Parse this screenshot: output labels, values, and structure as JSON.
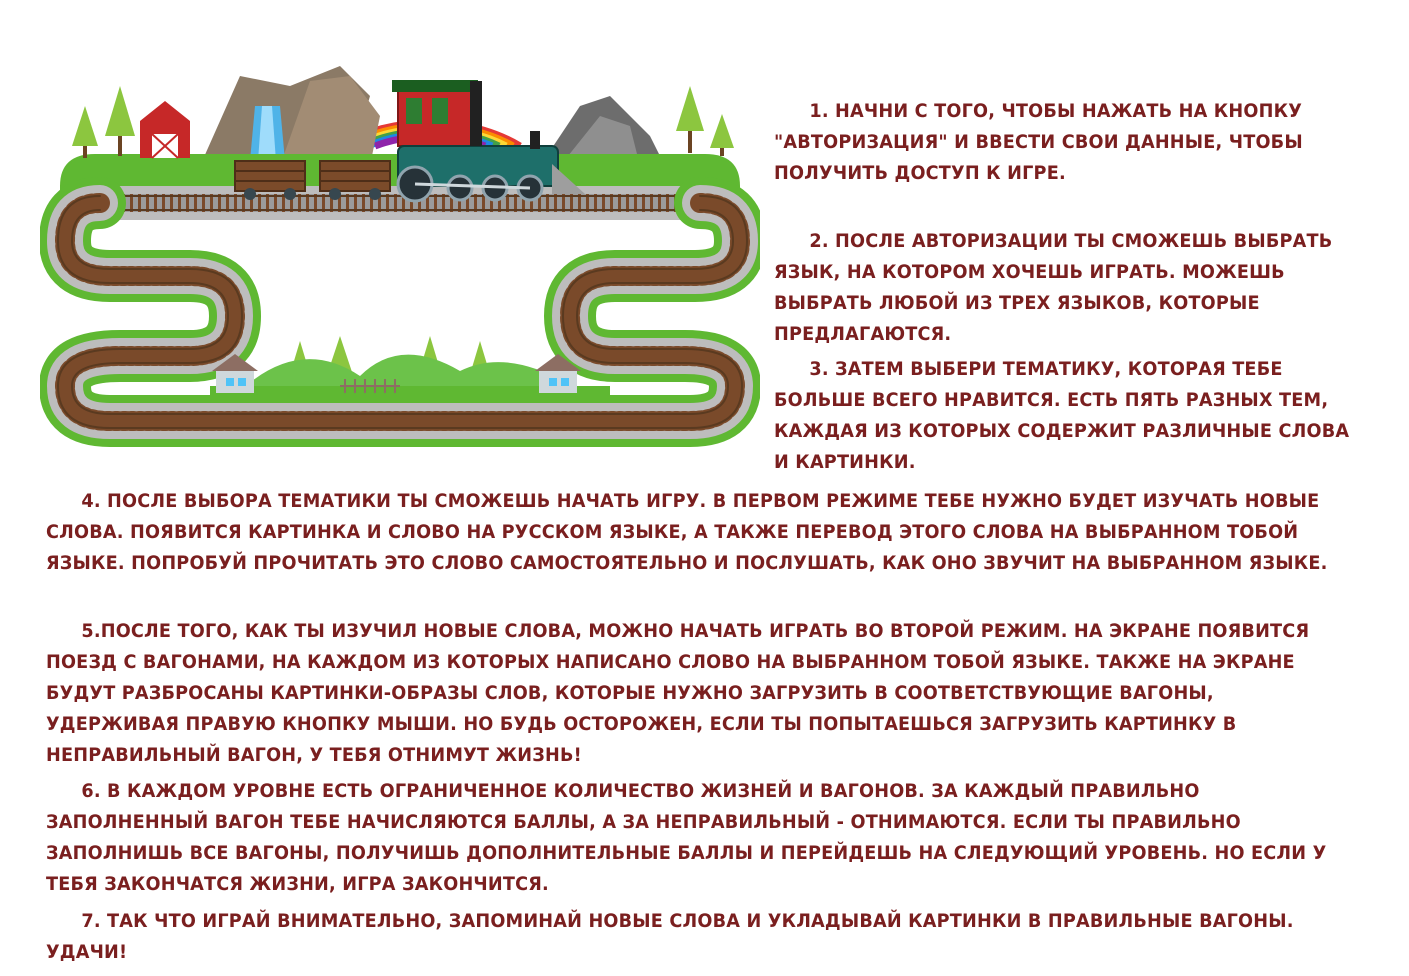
{
  "instructions": {
    "step1": "1. Начни с того, чтобы нажать на кнопку \"Авторизация\" и ввести свои данные, чтобы получить доступ к игре.",
    "step2": "2. После авторизации ты сможешь выбрать язык, на котором хочешь играть. Можешь выбрать любой из трех языков, которые предлагаются.",
    "step3": "3. Затем выбери тематику, которая тебе больше всего нравится. Есть пять разных тем, каждая из которых содержит различные слова и картинки.",
    "step4": "4. После выбора тематики ты сможешь начать игру. В первом режиме тебе нужно будет изучать новые слова. Появится картинка и слово на русском языке, а также перевод этого слова на выбранном тобой языке. Попробуй прочитать это слово самостоятельно и послушать, как оно звучит на выбранном языке.",
    "step5": "5.После того, как ты изучил новые слова, можно начать играть во второй режим. На экране появится поезд с вагонами, на каждом из которых написано слово на выбранном тобой языке. Также на экране будут разбросаны картинки-образы слов, которые нужно загрузить в соответствующие вагоны, удерживая правую кнопку мыши. Но будь осторожен, если ты попытаешься загрузить картинку в неправильный вагон, у тебя отнимут жизнь!",
    "step6": "6. В каждом уровне есть ограниченное количество жизней и вагонов. За каждый правильно заполненный вагон тебе начисляются баллы, а за неправильный - отнимаются. Если ты правильно заполнишь все вагоны, получишь дополнительные баллы и перейдешь на следующий уровень. Но если у тебя закончатся жизни, игра закончится.",
    "step7": "7. Так что играй внимательно, запоминай новые слова и укладывай картинки в правильные вагоны. Удачи!"
  },
  "colors": {
    "text": "#7a1f1f",
    "grass": "#5fb832",
    "track": "#9a9a9a",
    "rail": "#6b3a1e"
  },
  "illustration": {
    "icons": [
      "railway-track-icon",
      "steam-train-icon",
      "rainbow-icon",
      "red-barn-icon",
      "waterfall-icon",
      "mountain-icon",
      "pine-tree-icon",
      "house-icon"
    ]
  }
}
